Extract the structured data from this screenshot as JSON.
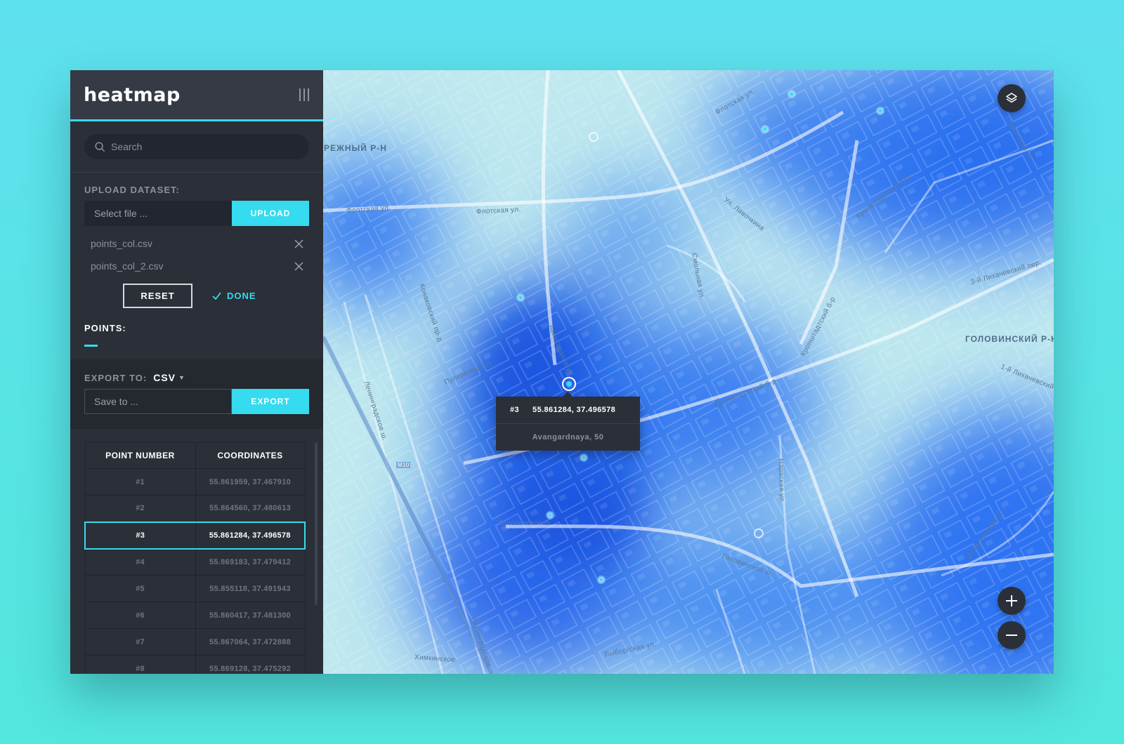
{
  "app": {
    "title": "heatmap"
  },
  "search": {
    "placeholder": "Search"
  },
  "upload": {
    "label": "UPLOAD DATASET:",
    "file_placeholder": "Select file ...",
    "button": "UPLOAD",
    "files": [
      {
        "name": "points_col.csv"
      },
      {
        "name": "points_col_2.csv"
      }
    ],
    "reset_button": "RESET",
    "done_button": "DONE"
  },
  "points": {
    "label": "POINTS:"
  },
  "export": {
    "label": "EXPORT TO:",
    "format": "CSV",
    "save_placeholder": "Save to ...",
    "button": "EXPORT"
  },
  "table": {
    "headers": [
      "POINT NUMBER",
      "COORDINATES"
    ],
    "selected_index": 2,
    "rows": [
      {
        "number": "#1",
        "coords": "55.861959, 37.467910"
      },
      {
        "number": "#2",
        "coords": "55.864560, 37.480613"
      },
      {
        "number": "#3",
        "coords": "55.861284, 37.496578"
      },
      {
        "number": "#4",
        "coords": "55.869183, 37.479412"
      },
      {
        "number": "#5",
        "coords": "55.855118, 37.491943"
      },
      {
        "number": "#6",
        "coords": "55.860417, 37.481300"
      },
      {
        "number": "#7",
        "coords": "55.867064, 37.472888"
      },
      {
        "number": "#8",
        "coords": "55.869128, 37.475292"
      }
    ]
  },
  "map": {
    "labels": [
      "РЕЖНЫЙ Р-Н",
      "Флотская ул.",
      "Флотская ул.",
      "ГОЛОВИНСКИЙ Р-Н",
      "Головинское ш.",
      "Головинское ш.",
      "Кронштадтский б-р",
      "Кронштадтский б-р",
      "Ленинградское ш.",
      "Авангардная ул.",
      "Пулковская ул.",
      "Онежская ул.",
      "Михалковская ул.",
      "3-й Лихачевский пер.",
      "1-й Лихачевский",
      "Нарвская ул.",
      "Конаковский пр-д",
      "М10",
      "Флотская ул.",
      "Ул. Лавочкина",
      "Смольная ул.",
      "Кронштадтский б-р",
      "Выборгская ул.",
      "Химкинское",
      "Ленинградское"
    ],
    "tooltip": {
      "number": "#3",
      "coords": "55.861284, 37.496578",
      "address": "Avangardnaya, 50"
    },
    "colors": {
      "heat_deep": "#1f5fe6",
      "heat_light": "#bfeaf0",
      "accent": "#35dbef"
    },
    "icons": [
      "layers-icon",
      "plus-icon",
      "minus-icon"
    ]
  }
}
